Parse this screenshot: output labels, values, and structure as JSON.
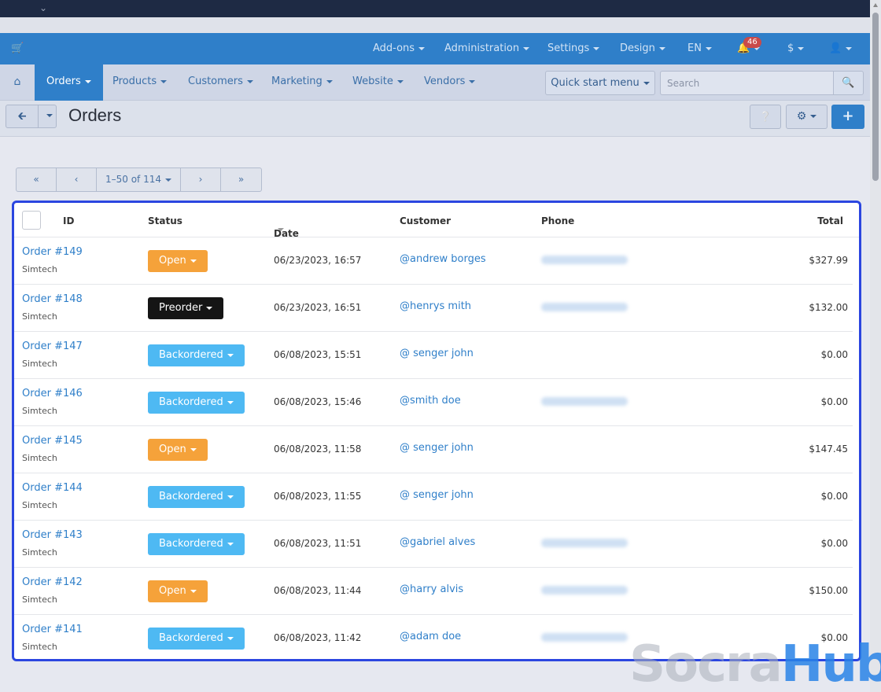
{
  "topnav": {
    "items": [
      "Add-ons",
      "Administration",
      "Settings",
      "Design",
      "EN",
      "$"
    ],
    "notifications_count": "46"
  },
  "mainnav": {
    "tabs": [
      "Orders",
      "Products",
      "Customers",
      "Marketing",
      "Website",
      "Vendors"
    ],
    "active": "Orders",
    "quick_start": "Quick start menu",
    "search_placeholder": "Search"
  },
  "page": {
    "title": "Orders"
  },
  "pagination": {
    "label": "1–50 of 114"
  },
  "table": {
    "columns": {
      "id": "ID",
      "status": "Status",
      "date": "Date",
      "customer": "Customer",
      "phone": "Phone",
      "total": "Total"
    },
    "rows": [
      {
        "id": "Order #149",
        "company": "Simtech",
        "status": "Open",
        "date": "06/23/2023, 16:57",
        "customer": "@andrew borges",
        "has_phone": true,
        "total": "$327.99"
      },
      {
        "id": "Order #148",
        "company": "Simtech",
        "status": "Preorder",
        "date": "06/23/2023, 16:51",
        "customer": "@henrys mith",
        "has_phone": true,
        "total": "$132.00"
      },
      {
        "id": "Order #147",
        "company": "Simtech",
        "status": "Backordered",
        "date": "06/08/2023, 15:51",
        "customer": "@ senger john",
        "has_phone": false,
        "total": "$0.00"
      },
      {
        "id": "Order #146",
        "company": "Simtech",
        "status": "Backordered",
        "date": "06/08/2023, 15:46",
        "customer": "@smith doe",
        "has_phone": true,
        "total": "$0.00"
      },
      {
        "id": "Order #145",
        "company": "Simtech",
        "status": "Open",
        "date": "06/08/2023, 11:58",
        "customer": "@ senger john",
        "has_phone": false,
        "total": "$147.45"
      },
      {
        "id": "Order #144",
        "company": "Simtech",
        "status": "Backordered",
        "date": "06/08/2023, 11:55",
        "customer": "@ senger john",
        "has_phone": false,
        "total": "$0.00"
      },
      {
        "id": "Order #143",
        "company": "Simtech",
        "status": "Backordered",
        "date": "06/08/2023, 11:51",
        "customer": "@gabriel alves",
        "has_phone": true,
        "total": "$0.00"
      },
      {
        "id": "Order #142",
        "company": "Simtech",
        "status": "Open",
        "date": "06/08/2023, 11:44",
        "customer": "@harry alvis",
        "has_phone": true,
        "total": "$150.00"
      },
      {
        "id": "Order #141",
        "company": "Simtech",
        "status": "Backordered",
        "date": "06/08/2023, 11:42",
        "customer": "@adam doe",
        "has_phone": true,
        "total": "$0.00"
      }
    ]
  },
  "status_colors": {
    "Open": "#f5a23a",
    "Preorder": "#151515",
    "Backordered": "#4eb9f3"
  },
  "watermark": {
    "part1": "Socra",
    "part2": "Hub"
  }
}
